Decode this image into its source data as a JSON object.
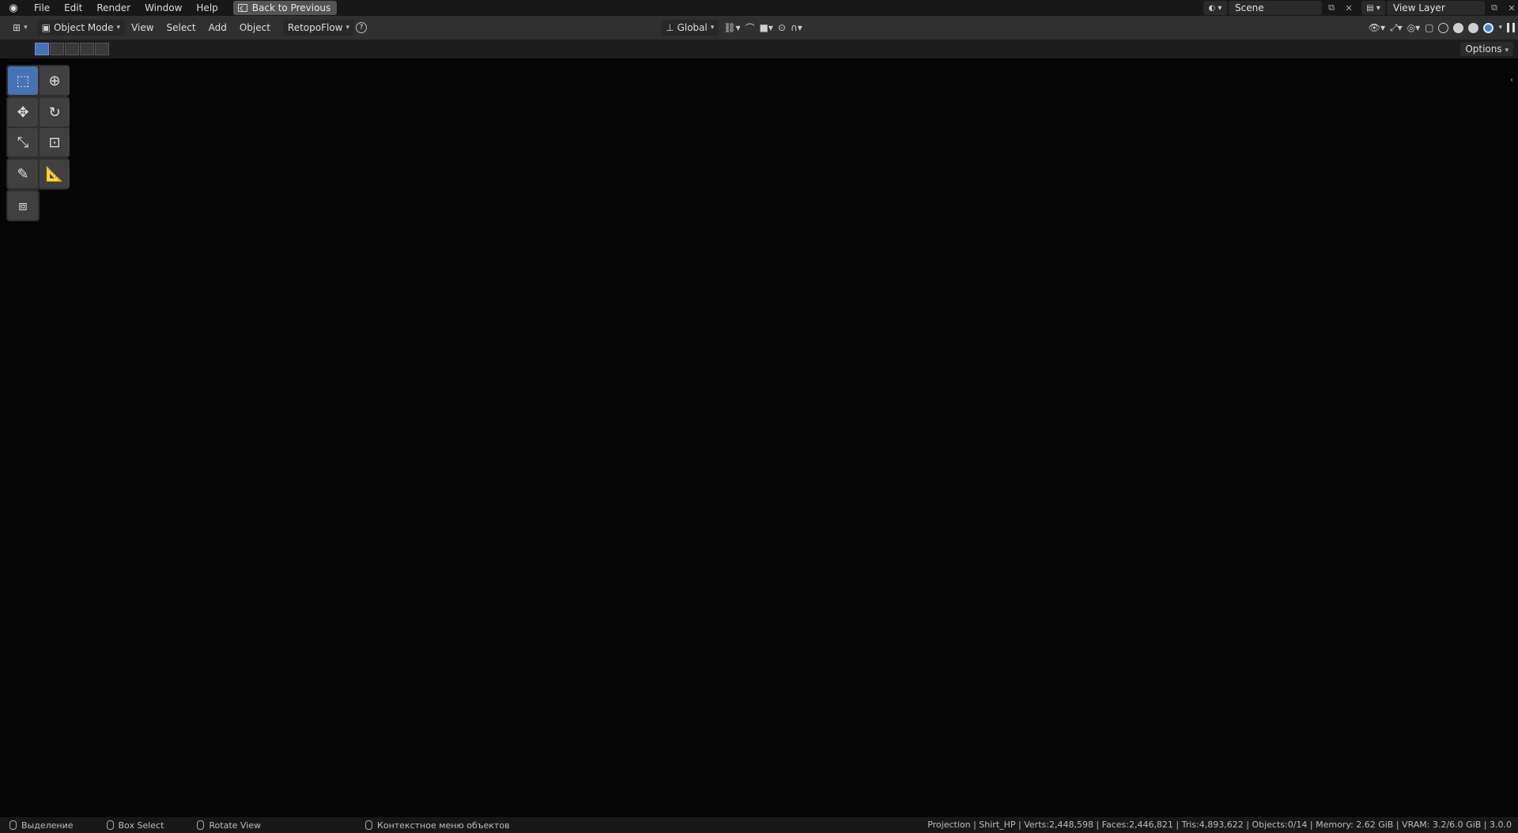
{
  "topbar": {
    "menus": [
      "File",
      "Edit",
      "Render",
      "Window",
      "Help"
    ],
    "back_label": "Back to Previous",
    "scene_name": "Scene",
    "view_layer": "View Layer"
  },
  "header": {
    "mode": "Object Mode",
    "menus": [
      "View",
      "Select",
      "Add",
      "Object"
    ],
    "addon": "RetopoFlow",
    "transform_orientation": "Global",
    "options_label": "Options"
  },
  "status": {
    "hint_select": "Выделение",
    "hint_box": "Box Select",
    "hint_rotate": "Rotate View",
    "hint_context": "Контекстное меню объектов",
    "stats": "Projection | Shirt_HP | Verts:2,448,598 | Faces:2,446,821 | Tris:4,893,622 | Objects:0/14 | Memory: 2.62 GiB | VRAM: 3.2/6.0 GiB | 3.0.0"
  }
}
